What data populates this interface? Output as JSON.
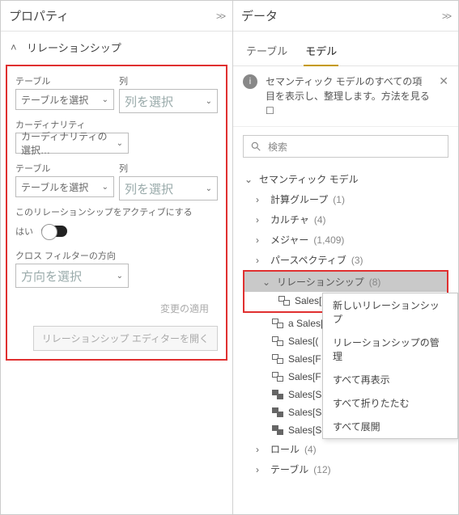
{
  "left": {
    "title": "プロパティ",
    "section": "リレーションシップ",
    "fields": {
      "table_label": "テーブル",
      "table_placeholder": "テーブルを選択",
      "column_label": "列",
      "column_placeholder": "列を選択",
      "cardinality_label": "カーディナリティ",
      "cardinality_placeholder": "カーディナリティの選択…",
      "active_label": "このリレーションシップをアクティブにする",
      "active_value": "はい",
      "crossfilter_label": "クロス フィルターの方向",
      "crossfilter_placeholder": "方向を選択"
    },
    "actions": {
      "apply": "変更の適用",
      "open_editor": "リレーションシップ エディターを開く"
    }
  },
  "right": {
    "title": "データ",
    "tabs": {
      "tables": "テーブル",
      "model": "モデル"
    },
    "info": "セマンティック モデルのすべての項目を表示し、整理します。方法を見る ☐",
    "search_placeholder": "検索",
    "tree": {
      "root": "セマンティック モデル",
      "groups": {
        "calc_groups": {
          "label": "計算グループ",
          "count": "(1)"
        },
        "cultures": {
          "label": "カルチャ",
          "count": "(4)"
        },
        "measures": {
          "label": "メジャー",
          "count": "(1,409)"
        },
        "perspectives": {
          "label": "パースペクティブ",
          "count": "(3)"
        },
        "relationships": {
          "label": "リレーションシップ",
          "count": "(8)"
        },
        "roles": {
          "label": "ロール",
          "count": "(4)"
        },
        "tables": {
          "label": "テーブル",
          "count": "(12)"
        }
      },
      "relationships_items": [
        "Sales[(",
        "a Sales[[",
        "Sales[(",
        "Sales[F",
        "Sales[F",
        "Sales[SalesOrderLineKey] ←  Sales Or…",
        "Sales[SalesTerritoryKey] <– Sales Te…",
        "Sales[ShipDateKey] <– Date[DateKey]"
      ]
    },
    "context_menu": {
      "new": "新しいリレーションシップ",
      "manage": "リレーションシップの管理",
      "reshow": "すべて再表示",
      "collapse": "すべて折りたたむ",
      "expand": "すべて展開"
    }
  }
}
